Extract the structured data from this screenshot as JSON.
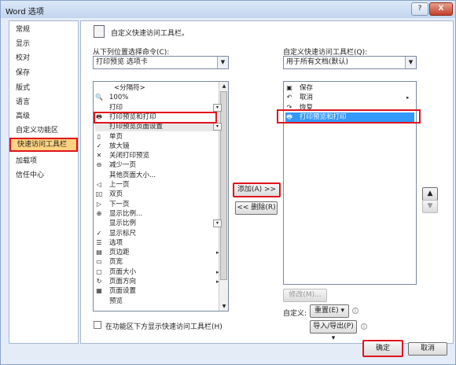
{
  "window": {
    "title": "Word 选项",
    "help": "?",
    "close": "X"
  },
  "nav": [
    "常规",
    "显示",
    "校对",
    "保存",
    "版式",
    "语言",
    "高级",
    "自定义功能区",
    "快速访问工具栏",
    "加载项",
    "信任中心"
  ],
  "header": {
    "text": "自定义快速访问工具栏。"
  },
  "left": {
    "choose_label": "从下列位置选择命令(C):",
    "choose_value": "打印预览 选项卡",
    "items": [
      {
        "icon": "",
        "label": "<分隔符>",
        "center": true
      },
      {
        "icon": "zoom-icon",
        "label": "100%"
      },
      {
        "icon": "",
        "label": "打印",
        "dd": true
      },
      {
        "icon": "print-preview-icon",
        "label": "打印预览和打印",
        "boxed": true
      },
      {
        "icon": "",
        "label": "打印预览页面设置",
        "highlight": true,
        "dd": true
      },
      {
        "icon": "single-page-icon",
        "label": "单页"
      },
      {
        "icon": "check-icon",
        "label": "放大镜"
      },
      {
        "icon": "close-preview-icon",
        "label": "关闭打印预览"
      },
      {
        "icon": "shrink-icon",
        "label": "减少一页"
      },
      {
        "icon": "",
        "label": "其他页面大小..."
      },
      {
        "icon": "prev-page-icon",
        "label": "上一页"
      },
      {
        "icon": "two-pages-icon",
        "label": "双页"
      },
      {
        "icon": "next-page-icon",
        "label": "下一页"
      },
      {
        "icon": "zoom-dialog-icon",
        "label": "显示比例..."
      },
      {
        "icon": "",
        "label": "显示比例",
        "dd": true
      },
      {
        "icon": "check-icon",
        "label": "显示标尺"
      },
      {
        "icon": "options-icon",
        "label": "选项"
      },
      {
        "icon": "margins-icon",
        "label": "页边距",
        "sub": true
      },
      {
        "icon": "page-width-icon",
        "label": "页宽"
      },
      {
        "icon": "page-size-icon",
        "label": "页面大小",
        "sub": true
      },
      {
        "icon": "orientation-icon",
        "label": "页面方向",
        "sub": true
      },
      {
        "icon": "page-setup-icon",
        "label": "页面设置"
      },
      {
        "icon": "",
        "label": "预览"
      }
    ],
    "show_below_label": "在功能区下方显示快速访问工具栏(H)"
  },
  "middle": {
    "add_label": "添加(A) >>",
    "remove_label": "<< 删除(R)"
  },
  "right": {
    "customize_label": "自定义快速访问工具栏(Q):",
    "customize_value": "用于所有文档(默认)",
    "items": [
      {
        "icon": "save-icon",
        "label": "保存"
      },
      {
        "icon": "undo-icon",
        "label": "取消",
        "sub": true
      },
      {
        "icon": "redo-icon",
        "label": "恢复"
      },
      {
        "icon": "print-preview-icon",
        "label": "打印预览和打印",
        "selected": true
      }
    ],
    "modify_label": "修改(M)...",
    "customizations_label": "自定义:",
    "reset_label": "重置(E) ▾",
    "import_export_label": "导入/导出(P) ▾"
  },
  "footer": {
    "ok_label": "确定",
    "cancel_label": "取消"
  }
}
